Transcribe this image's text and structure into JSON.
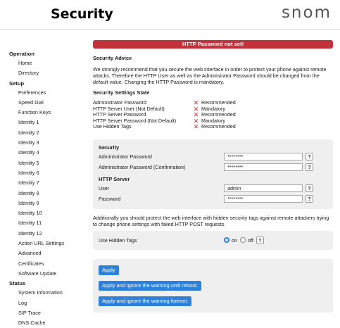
{
  "header": {
    "title": "Security",
    "brand": "snom"
  },
  "sidebar": {
    "sections": [
      {
        "label": "Operation",
        "items": [
          "Home",
          "Directory"
        ]
      },
      {
        "label": "Setup",
        "items": [
          "Preferences",
          "Speed Dial",
          "Function Keys",
          "Identity 1",
          "Identity 2",
          "Identity 3",
          "Identity 4",
          "Identity 5",
          "Identity 6",
          "Identity 7",
          "Identity 8",
          "Identity 9",
          "Identity 10",
          "Identity 11",
          "Identity 12",
          "Action URL Settings",
          "Advanced",
          "Certificates",
          "Software Update"
        ]
      },
      {
        "label": "Status",
        "items": [
          "System Information",
          "Log",
          "SIP Trace",
          "DNS Cache"
        ]
      }
    ]
  },
  "alert": {
    "text": "HTTP Password not set!",
    "color": "#c2323a"
  },
  "advice": {
    "title": "Security Advice",
    "text": "We strongly recommend that you secure the web interface in order to protect your phone against remote attacks. Therefore the HTTP User as well as the Administrator Password should be changed from the default value. Changing the HTTP Password is mandatory."
  },
  "state": {
    "title": "Security Settings State",
    "status_icon": "cross-icon",
    "status_symbol": "✕",
    "rows": [
      {
        "label": "Administrator Password",
        "status": "Recommended"
      },
      {
        "label": "HTTP Server User (Not Default)",
        "status": "Mandatory"
      },
      {
        "label": "HTTP Server Password",
        "status": "Recommended"
      },
      {
        "label": "HTTP Server Password (Not Default)",
        "status": "Mandatory"
      },
      {
        "label": "Use Hidden Tags",
        "status": "Recommended"
      }
    ]
  },
  "security_form": {
    "title": "Security",
    "admin_password_label": "Administrator Password",
    "admin_password_value": "********",
    "admin_password_confirm_label": "Administrator Password (Confirmation)",
    "admin_password_confirm_value": "********",
    "http_title": "HTTP Server",
    "user_label": "User",
    "user_value": "admin",
    "password_label": "Password",
    "password_value": "********",
    "help_symbol": "?"
  },
  "hidden_tags": {
    "text": "Additionally you should protect the web interface with hidden security tags against remote attackers trying to change phone settings with faked HTTP POST requests.",
    "label": "Use Hidden Tags",
    "on_label": "on",
    "off_label": "off",
    "selected": "on"
  },
  "buttons": {
    "apply": "Apply",
    "apply_until_reboot": "Apply and ignore the warning until reboot.",
    "apply_forever": "Apply and ignore the warning forever."
  },
  "colors": {
    "accent": "#2e81db",
    "alert": "#c2323a",
    "panel": "#efefef"
  }
}
